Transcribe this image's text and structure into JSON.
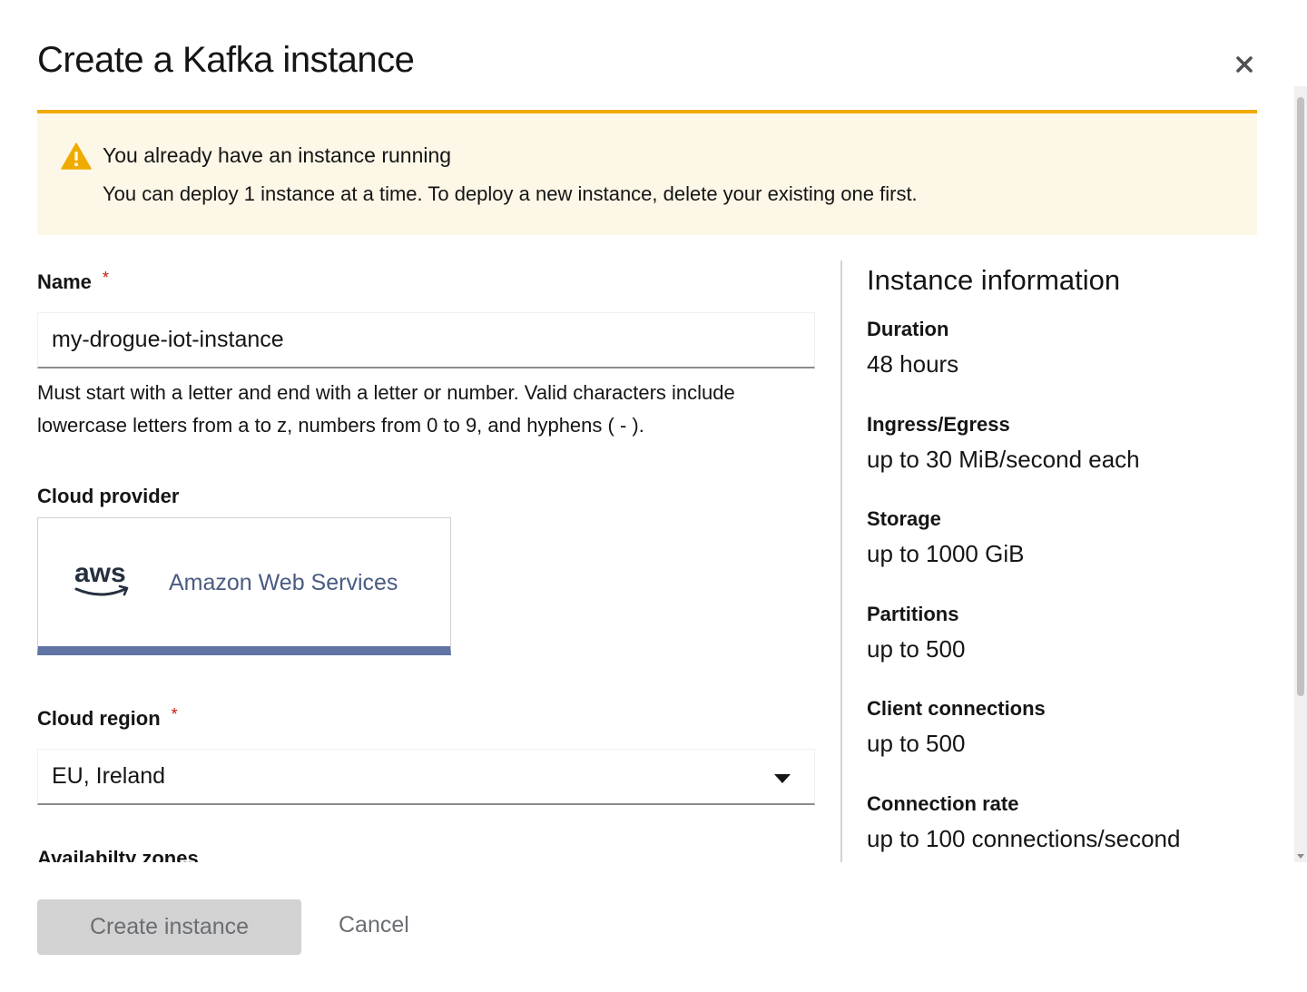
{
  "modal": {
    "title": "Create a Kafka instance",
    "close_icon": "close-icon"
  },
  "alert": {
    "icon": "warning-triangle-icon",
    "title": "You already have an instance running",
    "description": "You can deploy 1 instance at a time. To deploy a new instance, delete your existing one first."
  },
  "form": {
    "name": {
      "label": "Name",
      "required_mark": "*",
      "value": "my-drogue-iot-instance",
      "helper_line1": "Must start with a letter and end with a letter or number. Valid characters include",
      "helper_line2": "lowercase letters from a to z, numbers from 0 to 9, and hyphens ( - )."
    },
    "cloud_provider": {
      "label": "Cloud provider",
      "logo": "aws-logo",
      "logo_text": "aws",
      "name": "Amazon Web Services"
    },
    "cloud_region": {
      "label": "Cloud region",
      "required_mark": "*",
      "value": "EU, Ireland"
    },
    "availability_zones": {
      "label": "Availabilty zones"
    }
  },
  "instance_info": {
    "title": "Instance information",
    "items": [
      {
        "term": "Duration",
        "value": "48 hours"
      },
      {
        "term": "Ingress/Egress",
        "value": "up to 30 MiB/second each"
      },
      {
        "term": "Storage",
        "value": "up to 1000 GiB"
      },
      {
        "term": "Partitions",
        "value": "up to 500"
      },
      {
        "term": "Client connections",
        "value": "up to 500"
      },
      {
        "term": "Connection rate",
        "value": "up to 100 connections/second"
      }
    ]
  },
  "footer": {
    "create_label": "Create instance",
    "cancel_label": "Cancel"
  },
  "colors": {
    "warning_accent": "#f0ab00",
    "warning_bg": "#fdf7e7",
    "tile_selected": "#6074a4",
    "required": "#c9190b"
  }
}
